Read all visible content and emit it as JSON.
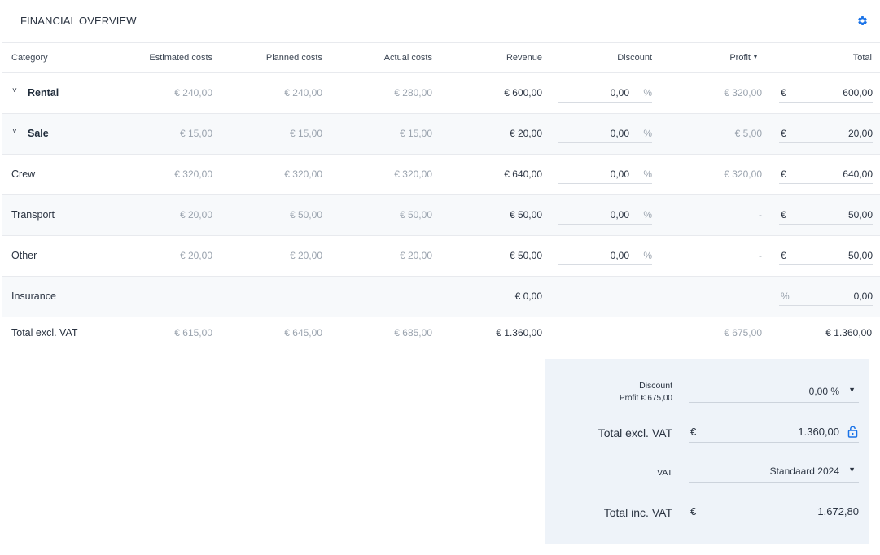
{
  "header": {
    "title": "FINANCIAL OVERVIEW",
    "settings_icon": "gear-icon"
  },
  "columns": {
    "category": "Category",
    "estimated": "Estimated costs",
    "planned": "Planned costs",
    "actual": "Actual costs",
    "revenue": "Revenue",
    "discount": "Discount",
    "profit": "Profit",
    "profit_sort_icon": "caret-down-icon",
    "total": "Total"
  },
  "rows": [
    {
      "category": "Rental",
      "expandable": true,
      "estimated": "€ 240,00",
      "planned": "€ 240,00",
      "actual": "€ 280,00",
      "revenue": "€ 600,00",
      "discount": "0,00",
      "discount_unit": "%",
      "profit": "€ 320,00",
      "total_currency": "€",
      "total": "600,00"
    },
    {
      "category": "Sale",
      "expandable": true,
      "estimated": "€ 15,00",
      "planned": "€ 15,00",
      "actual": "€ 15,00",
      "revenue": "€ 20,00",
      "discount": "0,00",
      "discount_unit": "%",
      "profit": "€ 5,00",
      "total_currency": "€",
      "total": "20,00"
    },
    {
      "category": "Crew",
      "expandable": false,
      "estimated": "€ 320,00",
      "planned": "€ 320,00",
      "actual": "€ 320,00",
      "revenue": "€ 640,00",
      "discount": "0,00",
      "discount_unit": "%",
      "profit": "€ 320,00",
      "total_currency": "€",
      "total": "640,00"
    },
    {
      "category": "Transport",
      "expandable": false,
      "estimated": "€ 20,00",
      "planned": "€ 50,00",
      "actual": "€ 50,00",
      "revenue": "€ 50,00",
      "discount": "0,00",
      "discount_unit": "%",
      "profit": "-",
      "total_currency": "€",
      "total": "50,00"
    },
    {
      "category": "Other",
      "expandable": false,
      "estimated": "€ 20,00",
      "planned": "€ 20,00",
      "actual": "€ 20,00",
      "revenue": "€ 50,00",
      "discount": "0,00",
      "discount_unit": "%",
      "profit": "-",
      "total_currency": "€",
      "total": "50,00"
    },
    {
      "category": "Insurance",
      "revenue": "€ 0,00",
      "total_currency": "%",
      "total": "0,00"
    }
  ],
  "totals_row": {
    "label": "Total excl. VAT",
    "estimated": "€ 615,00",
    "planned": "€ 645,00",
    "actual": "€ 685,00",
    "revenue": "€ 1.360,00",
    "profit": "€ 675,00",
    "total": "€ 1.360,00"
  },
  "summary": {
    "discount_label": "Discount",
    "profit_label": "Profit € 675,00",
    "discount_value": "0,00 %",
    "total_excl_label": "Total excl. VAT",
    "total_excl_currency": "€",
    "total_excl_value": "1.360,00",
    "lock_icon": "lock-icon",
    "vat_label": "VAT",
    "vat_value": "Standaard 2024",
    "total_inc_label": "Total inc. VAT",
    "total_inc_currency": "€",
    "total_inc_value": "1.672,80"
  },
  "colors": {
    "accent": "#1a73e8",
    "summary_bg": "#eef3f9",
    "alt_row_bg": "#f7f9fb"
  }
}
